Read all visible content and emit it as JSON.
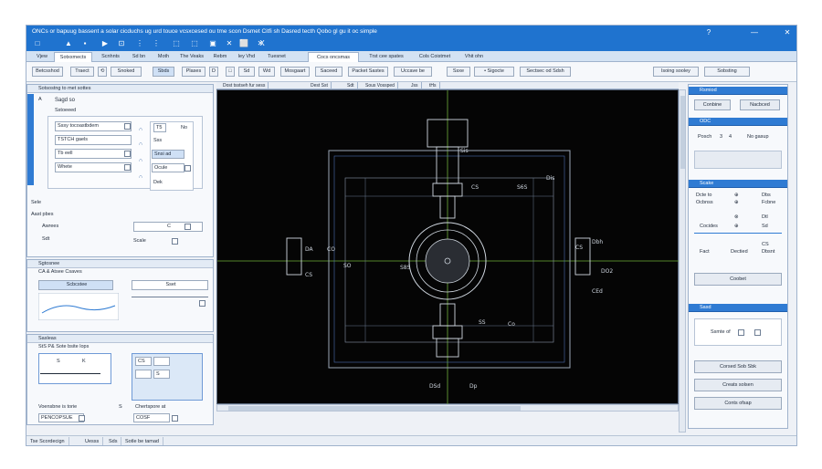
{
  "window": {
    "title": "ONCs or bapuug bassent a solar cicduchs ug urd touce vcsxcesed ou tme scon Dsmet Citfi sh Dasred tecth Qobo gl gu it oc simple",
    "controls": [
      "?",
      "—",
      "✕"
    ]
  },
  "quick_access": [
    "□",
    "▲",
    "▪",
    "▶",
    "⊡",
    "⋮",
    "⋮",
    "⬚",
    "⬚",
    "▣",
    "✕",
    "⬜",
    "✕",
    "X"
  ],
  "tabs": [
    "Vjew",
    "Sotxxmects",
    "Scnhnts",
    "Sd bn",
    "Moth",
    "The Veaks",
    "Rebm",
    "ley Vhd",
    "Tuesnet",
    "Cocs oncsmas",
    "Trst cee spates",
    "Cols Coistmet",
    "Vhit ohn"
  ],
  "ribbon": [
    "Betcsshod",
    "Traect",
    "⟲",
    "Snoked",
    "Sbds",
    "Plases",
    "D",
    "□",
    "Sd",
    "Wd",
    "Mosgaart",
    "Saceed",
    "Packet Sastes",
    "Uccave be",
    "Ssxe",
    "• Sigocte",
    "Sectsec od Sdsh",
    "lsoing sooley",
    "Sobsting"
  ],
  "left_panel": {
    "section1": {
      "header": "Sotsostng to met sottes",
      "sub": "Sagd so",
      "sub2": "Sstoeeed",
      "rows": [
        "Sssy tocoastbdem",
        "TSTCH gaels",
        "Tb eell",
        "Whete"
      ],
      "right_col": [
        "T5",
        "No",
        "Sss",
        "Snsi ad",
        "Ocule",
        "Dek"
      ],
      "side_marks": [
        "A",
        "∩",
        "∩",
        "∩",
        "∩"
      ]
    },
    "section2": {
      "title": "Sele",
      "sub": "Aast pbes",
      "label1": "Awrees",
      "field1": "C",
      "label2": "Sdt",
      "label3": "Scale"
    },
    "section3": {
      "header": "Sgtosnee",
      "sub": "CA & Atsee Csaves",
      "field1": "Scbcstee",
      "field2": "Sset"
    },
    "section4": {
      "header": "Sasleas",
      "sub": "StS P& Sote bsite lops",
      "mini": [
        "S",
        "K",
        "CS",
        "S"
      ],
      "label1": "Voensbne is torie",
      "label2": "Chertspore at",
      "field1": "PENCOPSUE",
      "field2": "COSF"
    }
  },
  "canvas": {
    "tabs": [
      "Dost tsstseh fur sess",
      "Dest Sst",
      "Sdt",
      "Sous Vossped",
      "Jss",
      "tHs"
    ],
    "labels": [
      "Sis",
      "CS",
      "S6S",
      "Dis",
      "DA",
      "CO",
      "SO",
      "S8S",
      "Dbh",
      "CS",
      "DO2",
      "CS",
      "CEd",
      "SS",
      "Co",
      "DSd",
      "Dp"
    ]
  },
  "right_panel": {
    "sec1": {
      "header": "Rsmiod",
      "btn1": "Conbine",
      "btn2": "Nacbced"
    },
    "sec2": {
      "header": "ODC",
      "row": "Posch",
      "val1": "3",
      "val2": "4",
      "val3": "No gasup"
    },
    "sec3": {
      "header": "Scake",
      "rows": [
        {
          "a": "Dcte to",
          "b": "⊕",
          "c": "Dbs"
        },
        {
          "a": "Ocbnss",
          "b": "⊕",
          "c": "Fcbne"
        },
        {
          "a": "",
          "b": "⊗",
          "c": "Dtl"
        },
        {
          "a": "Cocides",
          "b": "⊕",
          "c": "Sd"
        }
      ],
      "row5a": "CS",
      "row6a": "Fact",
      "row6b": "Dectied",
      "row6c": "Dbsnt",
      "btn": "Coobet"
    },
    "sec4": {
      "header": "Sasd",
      "label": "Ssmte of"
    },
    "buttons": [
      "Corsed Sob Sbk",
      "Creats solsen",
      "Conts ofsap"
    ]
  },
  "statusbar": [
    "Tse Scordecign",
    "Uesss",
    "Sds",
    "Sotle be tamad"
  ]
}
